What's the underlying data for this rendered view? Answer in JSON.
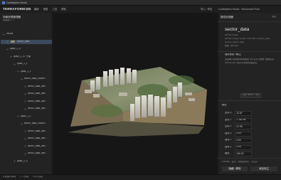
{
  "window": {
    "title": "CardMasters Studio"
  },
  "menu": {
    "brand": "TERRAFORM OS",
    "items": [
      "文件",
      "编辑",
      "视图",
      "工具",
      "帮助"
    ],
    "actions": [
      "导入 / 导出",
      "CardMasters Studio · Benchmark Final"
    ]
  },
  "left_panel": {
    "title": "场景资源管理器",
    "subtitle": "数据集 2 个",
    "tree": [
      {
        "label": "Result",
        "depth": 0,
        "expanded": true,
        "selected": false,
        "thumb": false
      },
      {
        "label": "sector_data",
        "depth": 1,
        "expanded": false,
        "selected": true,
        "thumb": true
      },
      {
        "label": "quad_1_0",
        "depth": 1,
        "expanded": true,
        "selected": false,
        "thumb": false
      },
      {
        "label": "quad_1_0 / 子集",
        "depth": 2,
        "expanded": true,
        "selected": false,
        "thumb": false
      },
      {
        "label": "quad_1_1",
        "depth": 3,
        "expanded": true,
        "selected": false,
        "thumb": false
      },
      {
        "label": "quad_1_1",
        "depth": 4,
        "expanded": true,
        "selected": false,
        "thumb": false
      },
      {
        "label": "sector_data_hucket...",
        "depth": 5,
        "expanded": true,
        "selected": false,
        "thumb": false
      },
      {
        "label": "sector_data_lber...",
        "depth": 6,
        "expanded": false,
        "selected": false,
        "thumb": false
      },
      {
        "label": "sector_data_lber...",
        "depth": 6,
        "expanded": false,
        "selected": false,
        "thumb": false
      },
      {
        "label": "sector_data_lber...",
        "depth": 6,
        "expanded": false,
        "selected": false,
        "thumb": false
      },
      {
        "label": "sector_data_lber...",
        "depth": 6,
        "expanded": false,
        "selected": false,
        "thumb": false
      },
      {
        "label": "quad_1_1",
        "depth": 4,
        "expanded": true,
        "selected": false,
        "thumb": false
      },
      {
        "label": "sector_data_hucket...",
        "depth": 5,
        "expanded": true,
        "selected": false,
        "thumb": false
      },
      {
        "label": "sector_data_lber...",
        "depth": 6,
        "expanded": false,
        "selected": false,
        "thumb": false
      },
      {
        "label": "sector_data_lber...",
        "depth": 6,
        "expanded": false,
        "selected": false,
        "thumb": false
      },
      {
        "label": "sector_data_lber...",
        "depth": 6,
        "expanded": false,
        "selected": false,
        "thumb": false
      },
      {
        "label": "sector_data_lber...",
        "depth": 6,
        "expanded": false,
        "selected": false,
        "thumb": false
      },
      {
        "label": "quad_1_0",
        "depth": 3,
        "expanded": false,
        "selected": false,
        "thumb": false
      }
    ]
  },
  "right_panel": {
    "section_title": "属性检视器",
    "section_action": "关闭",
    "asset_name": "sector_data",
    "meta_lines": [
      "3D Tile Group",
      "3D Tile Group / mesh / 124 413 / version_data",
      "source: sector_data",
      "模型: 3D Tiles"
    ],
    "desc_title": "描述信息 / 备注",
    "desc_lines": [
      "这是单元地块的倾斜模型 (3D 瓦片) 数据, 数据来源",
      "CM-Render 的实景测量处理输出。"
    ],
    "pill": "查看 Mesh / 详情",
    "props_title": "属性",
    "props": [
      {
        "label": "坐标 X",
        "value": "22.87"
      },
      {
        "label": "坐标 Y",
        "value": "1 182.96"
      },
      {
        "label": "坐标 Z",
        "value": "47.95"
      },
      {
        "label": "旋转 X",
        "value": "0.00"
      },
      {
        "label": "旋转 Y",
        "value": "0.00"
      },
      {
        "label": "旋转 Z",
        "value": "0.00"
      },
      {
        "label": "缩放",
        "value": "100.00"
      }
    ],
    "footnote": "TOCER · 显示 · 添加到场景 · 不显示",
    "buttons": [
      "隐藏 / 移除",
      "添加到主"
    ]
  },
  "status_bar": {
    "items": [
      "● 就绪 ready",
      "1 个对象",
      "GPU 渲染"
    ]
  },
  "colors": {
    "selection": "#3b4a5e",
    "viewport_bg": "#161616",
    "panel_bg": "#232323"
  }
}
